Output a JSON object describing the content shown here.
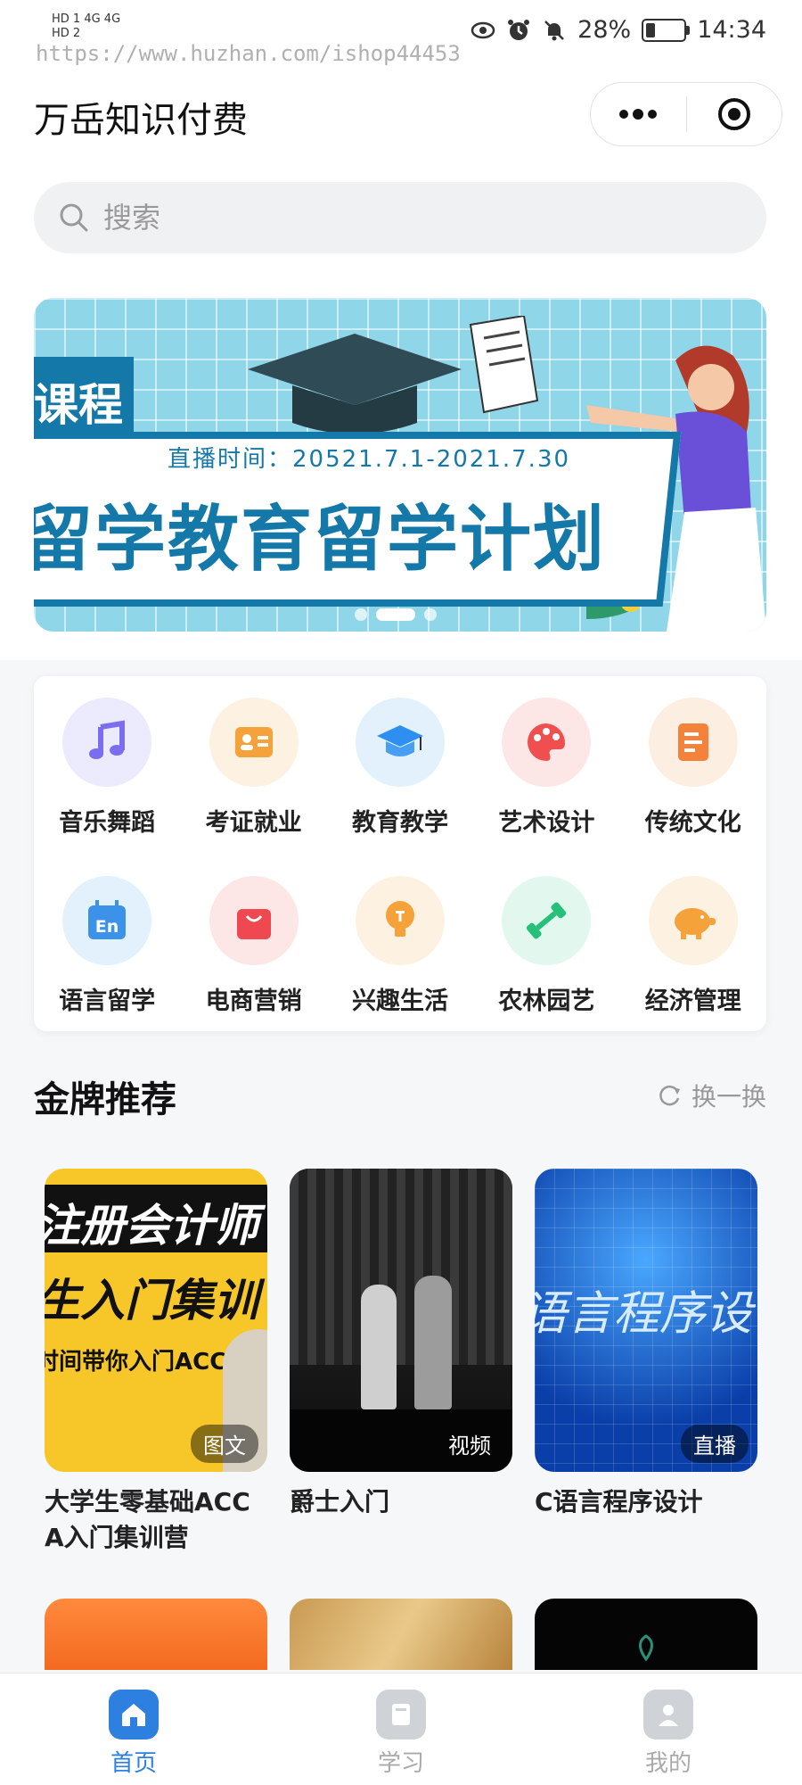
{
  "status_bar": {
    "network_left": "HD 1  4G  4G",
    "network_left2": "HD 2",
    "watermark": "https://www.huzhan.com/ishop44453",
    "battery": "28%",
    "battery_level": 0.28,
    "time": "14:34",
    "icons": [
      "eye-icon",
      "alarm-icon",
      "mute-bell-icon",
      "battery-icon"
    ]
  },
  "header": {
    "title": "万岳知识付费",
    "capsule_icons": [
      "more-dots-icon",
      "close-target-icon"
    ]
  },
  "search": {
    "placeholder": "搜索",
    "icon": "search-icon"
  },
  "banner": {
    "tag": "课程",
    "time_text": "直播时间：20521.7.1-2021.7.30",
    "headline": "留学教育留学计划",
    "slide_count": 3,
    "active_slide": 2
  },
  "categories": [
    {
      "label": "音乐舞蹈",
      "icon": "music-note-icon",
      "color": "#7b6cf0",
      "bg": "#ecebfd"
    },
    {
      "label": "考证就业",
      "icon": "id-card-icon",
      "color": "#f5a23a",
      "bg": "#fdf1e2"
    },
    {
      "label": "教育教学",
      "icon": "graduation-cap-icon",
      "color": "#2d8ff0",
      "bg": "#e3f1fd"
    },
    {
      "label": "艺术设计",
      "icon": "palette-icon",
      "color": "#ef4f4f",
      "bg": "#fde6e6"
    },
    {
      "label": "传统文化",
      "icon": "document-icon",
      "color": "#f5823a",
      "bg": "#fdeee2"
    },
    {
      "label": "语言留学",
      "icon": "calendar-en-icon",
      "color": "#3b92e8",
      "bg": "#e3f1fd"
    },
    {
      "label": "电商营销",
      "icon": "shopping-bag-icon",
      "color": "#ef4850",
      "bg": "#fde6e6"
    },
    {
      "label": "兴趣生活",
      "icon": "lightbulb-icon",
      "color": "#f5a23a",
      "bg": "#fdf1e2"
    },
    {
      "label": "农林园艺",
      "icon": "dumbbell-icon",
      "color": "#27c07a",
      "bg": "#e2f7ed"
    },
    {
      "label": "经济管理",
      "icon": "piggy-bank-icon",
      "color": "#f5a23a",
      "bg": "#fdf1e2"
    }
  ],
  "section": {
    "title": "金牌推荐",
    "refresh_label": "换一换",
    "refresh_icon": "refresh-icon"
  },
  "courses": [
    {
      "title": "大学生零基础ACCA入门集训营",
      "badge": "图文",
      "cover_text_1": "注册会计师",
      "cover_text_2": "生入门集训",
      "cover_text_3": "时间带你入门ACCA"
    },
    {
      "title": "爵士入门",
      "badge": "视频"
    },
    {
      "title": "C语言程序设计",
      "badge": "直播",
      "cover_text_1": "语言程序设"
    }
  ],
  "tabbar": {
    "items": [
      {
        "label": "首页",
        "icon": "home-icon",
        "active": true
      },
      {
        "label": "学习",
        "icon": "book-icon",
        "active": false
      },
      {
        "label": "我的",
        "icon": "profile-icon",
        "active": false
      }
    ],
    "active_color": "#2d7fe0",
    "inactive_color": "#aaaaaa"
  }
}
